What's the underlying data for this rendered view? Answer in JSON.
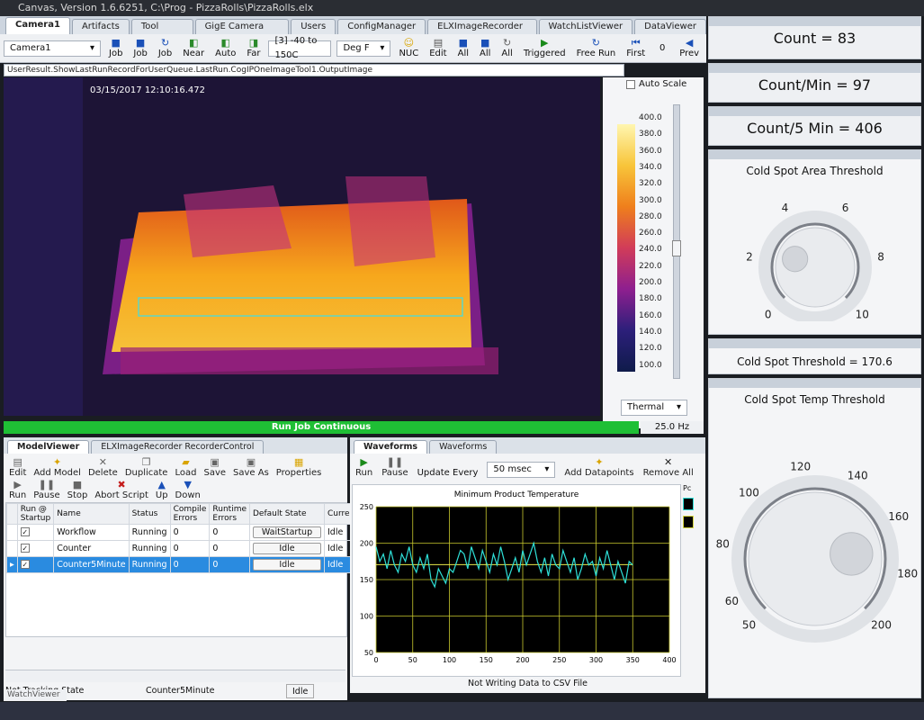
{
  "window": {
    "title": "Canvas, Version 1.6.6251, C:\\Prog - PizzaRolls\\PizzaRolls.elx"
  },
  "tabs": [
    "Camera1",
    "Artifacts",
    "Tool Regions",
    "GigE Camera Settings",
    "Users",
    "ConfigManager",
    "ELXImageRecorder Viewer",
    "WatchListViewer",
    "DataViewer"
  ],
  "toolbar": {
    "camera": "Camera1",
    "job_buttons": [
      "Job",
      "Job",
      "Job"
    ],
    "focus_buttons": [
      "Near",
      "Auto",
      "Far"
    ],
    "range": "[3] -40 to 150C",
    "units": "Deg F",
    "nuc": "NUC",
    "edit": "Edit",
    "all_buttons": [
      "All",
      "All",
      "All"
    ],
    "triggered": "Triggered",
    "free_run": "Free Run",
    "first": "First",
    "frame": "0",
    "prev": "Prev"
  },
  "image": {
    "path": "UserResult.ShowLastRunRecordForUserQueue.LastRun.CogIPOneImageTool1.OutputImage",
    "timestamp": "03/15/2017 12:10:16.472"
  },
  "colorbar": {
    "auto_scale": "Auto Scale",
    "ticks": [
      "400.0",
      "380.0",
      "360.0",
      "340.0",
      "320.0",
      "300.0",
      "280.0",
      "260.0",
      "240.0",
      "220.0",
      "200.0",
      "180.0",
      "160.0",
      "140.0",
      "120.0",
      "100.0"
    ],
    "palette": "Thermal"
  },
  "status": {
    "run_job": "Run Job Continuous",
    "rate": "25.0 Hz"
  },
  "model_viewer": {
    "tabs": [
      "ModelViewer",
      "ELXImageRecorder RecorderControl"
    ],
    "tools1": [
      "Edit",
      "Add Model",
      "Delete",
      "Duplicate",
      "Load",
      "Save",
      "Save As",
      "Properties"
    ],
    "tools2": [
      "Run",
      "Pause",
      "Stop",
      "Abort Script",
      "Up",
      "Down"
    ],
    "columns": [
      "Run @ Startup",
      "Name",
      "Status",
      "Compile Errors",
      "Runtime Errors",
      "Default State",
      "Current"
    ],
    "rows": [
      {
        "name": "Workflow",
        "status": "Running",
        "compile": "0",
        "runtime": "0",
        "default": "WaitStartup",
        "current": "Idle"
      },
      {
        "name": "Counter",
        "status": "Running",
        "compile": "0",
        "runtime": "0",
        "default": "Idle",
        "current": "Idle"
      },
      {
        "name": "Counter5Minute",
        "status": "Running",
        "compile": "0",
        "runtime": "0",
        "default": "Idle",
        "current": "Idle"
      }
    ],
    "footer": {
      "tracking": "Not Tracking State",
      "model": "Counter5Minute",
      "state": "Idle"
    }
  },
  "waveforms": {
    "tabs": [
      "Waveforms",
      "Waveforms"
    ],
    "run": "Run",
    "pause": "Pause",
    "update_label": "Update Every",
    "update_value": "50 msec",
    "add": "Add Datapoints",
    "remove": "Remove All",
    "footer": "Not Writing Data to CSV File",
    "legend": "Pc"
  },
  "chart_data": {
    "type": "line",
    "title": "Minimum Product Temperature",
    "xlim": [
      0,
      400
    ],
    "ylim": [
      50,
      250
    ],
    "xticks": [
      0,
      50,
      100,
      150,
      200,
      250,
      300,
      350,
      400
    ],
    "yticks": [
      50,
      100,
      150,
      200,
      250
    ],
    "grid": true,
    "threshold": 170.6,
    "series": [
      {
        "x": [
          0,
          5,
          10,
          15,
          20,
          25,
          30,
          35,
          40,
          45,
          50,
          55,
          60,
          65,
          70,
          75,
          80,
          85,
          90,
          95,
          100,
          105,
          110,
          115,
          120,
          125,
          130,
          135,
          140,
          145,
          150,
          155,
          160,
          165,
          170,
          175,
          180,
          185,
          190,
          195,
          200,
          205,
          210,
          215,
          220,
          225,
          230,
          235,
          240,
          245,
          250,
          255,
          260,
          265,
          270,
          275,
          280,
          285,
          290,
          295,
          300,
          305,
          310,
          315,
          320,
          325,
          330,
          335,
          340,
          345,
          350
        ],
        "y": [
          195,
          175,
          185,
          165,
          190,
          170,
          160,
          185,
          175,
          195,
          170,
          160,
          180,
          165,
          185,
          150,
          140,
          165,
          155,
          145,
          165,
          160,
          175,
          190,
          185,
          165,
          195,
          180,
          165,
          190,
          175,
          160,
          185,
          170,
          195,
          175,
          150,
          165,
          180,
          160,
          190,
          170,
          185,
          200,
          175,
          160,
          180,
          155,
          185,
          170,
          165,
          190,
          175,
          160,
          180,
          150,
          165,
          185,
          170,
          175,
          155,
          180,
          165,
          190,
          170,
          150,
          175,
          160,
          145,
          175,
          170
        ]
      }
    ],
    "color": "#2ee0d8"
  },
  "right": {
    "count": "Count = 83",
    "count_min": "Count/Min = 97",
    "count_5min": "Count/5 Min = 406",
    "area_title": "Cold Spot Area Threshold",
    "area_ticks": [
      "2",
      "4",
      "6",
      "8",
      "0",
      "10"
    ],
    "area_value": 2.5,
    "threshold_label": "Cold Spot Threshold = 170.6",
    "temp_title": "Cold Spot Temp Threshold",
    "temp_ticks": [
      "50",
      "60",
      "80",
      "100",
      "120",
      "140",
      "160",
      "180",
      "200"
    ],
    "temp_value": 170.6
  },
  "watch": "WatchViewer"
}
